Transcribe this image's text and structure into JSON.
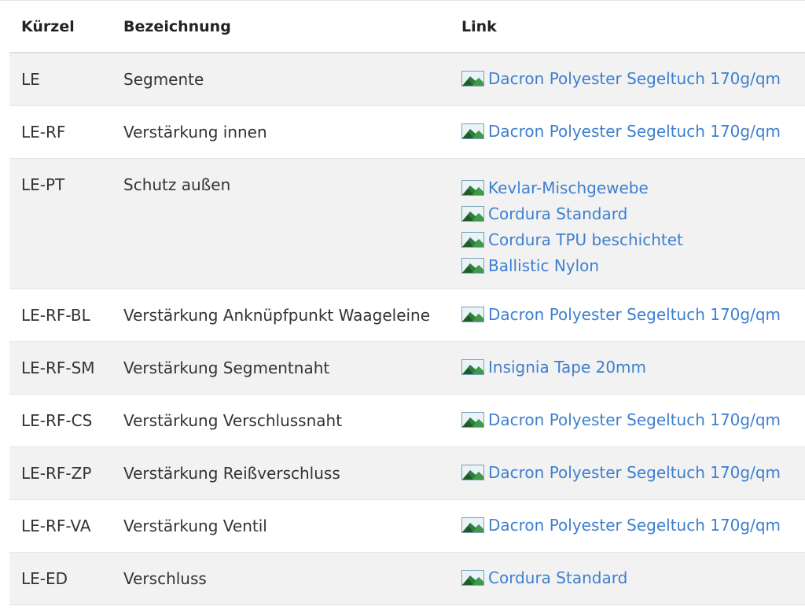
{
  "table": {
    "headers": {
      "abbr": "Kürzel",
      "name": "Bezeichnung",
      "link": "Link"
    },
    "rows": [
      {
        "abbr": "LE",
        "name": "Segmente",
        "links": [
          "Dacron Polyester Segeltuch 170g/qm"
        ]
      },
      {
        "abbr": "LE-RF",
        "name": "Verstärkung innen",
        "links": [
          "Dacron Polyester Segeltuch 170g/qm"
        ]
      },
      {
        "abbr": "LE-PT",
        "name": "Schutz außen",
        "links": [
          "Kevlar-Mischgewebe",
          "Cordura Standard",
          "Cordura TPU beschichtet",
          "Ballistic Nylon"
        ]
      },
      {
        "abbr": "LE-RF-BL",
        "name": "Verstärkung Anknüpfpunkt Waageleine",
        "links": [
          "Dacron Polyester Segeltuch 170g/qm"
        ]
      },
      {
        "abbr": "LE-RF-SM",
        "name": "Verstärkung Segmentnaht",
        "links": [
          "Insignia Tape 20mm"
        ]
      },
      {
        "abbr": "LE-RF-CS",
        "name": "Verstärkung Verschlussnaht",
        "links": [
          "Dacron Polyester Segeltuch 170g/qm"
        ]
      },
      {
        "abbr": "LE-RF-ZP",
        "name": "Verstärkung Reißverschluss",
        "links": [
          "Dacron Polyester Segeltuch 170g/qm"
        ]
      },
      {
        "abbr": "LE-RF-VA",
        "name": "Verstärkung Ventil",
        "links": [
          "Dacron Polyester Segeltuch 170g/qm"
        ]
      },
      {
        "abbr": "LE-ED",
        "name": "Verschluss",
        "links": [
          "Cordura Standard"
        ]
      }
    ]
  },
  "icon": "image-icon",
  "colors": {
    "link": "#3d7fd0",
    "row_alt": "#f2f2f2",
    "text": "#333333"
  }
}
